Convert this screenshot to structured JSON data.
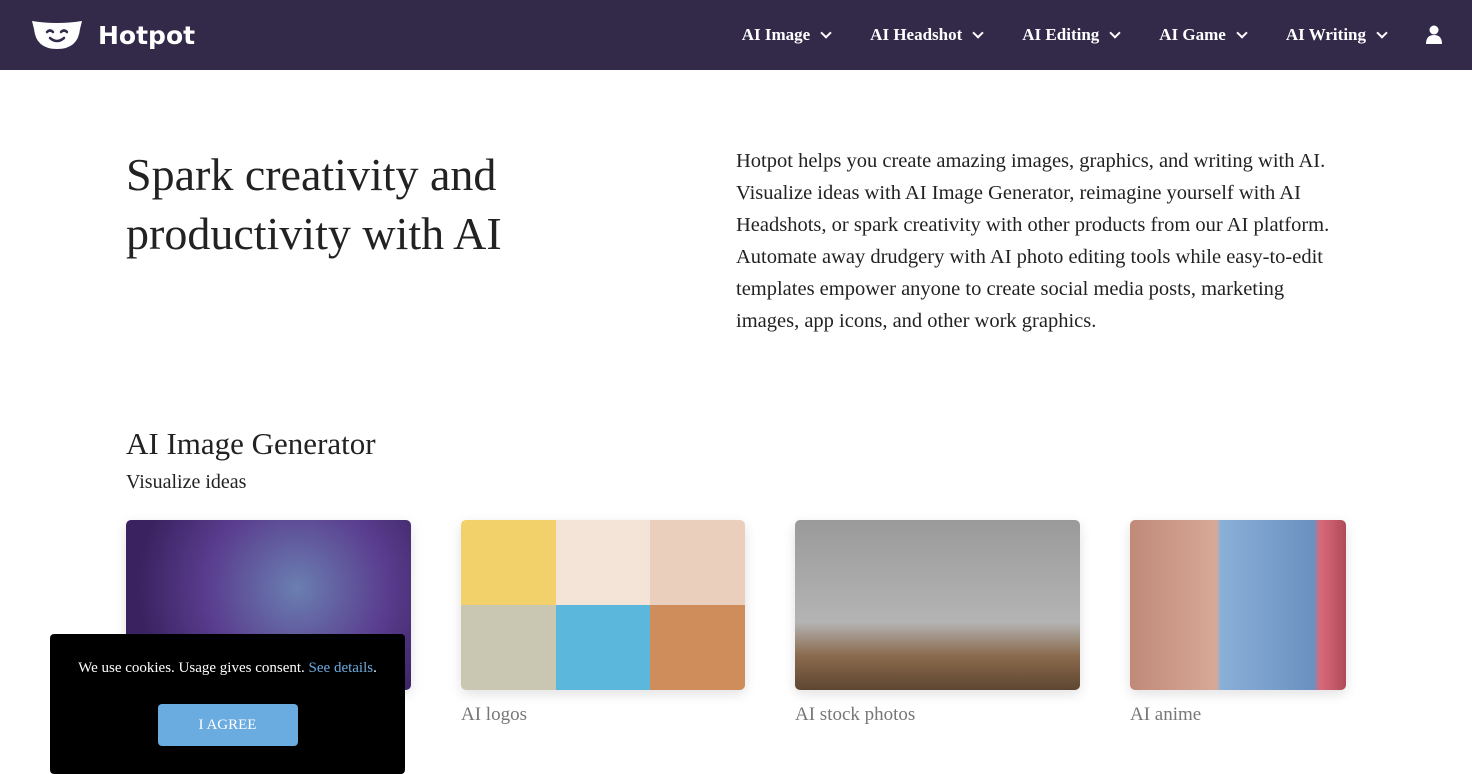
{
  "nav": {
    "brand": "Hotpot",
    "items": [
      {
        "label": "AI Image"
      },
      {
        "label": "AI Headshot"
      },
      {
        "label": "AI Editing"
      },
      {
        "label": "AI Game"
      },
      {
        "label": "AI Writing"
      }
    ],
    "bg": "#332a4a"
  },
  "hero": {
    "title": "Spark creativity and productivity with AI",
    "description": "Hotpot helps you create amazing images, graphics, and writing with AI. Visualize ideas with AI Image Generator, reimagine yourself with AI Headshots, or spark creativity with other products from our AI platform. Automate away drudgery with AI photo editing tools while easy-to-edit templates empower anyone to create social media posts, marketing images, app icons, and other work graphics."
  },
  "section": {
    "title": "AI Image Generator",
    "subtitle": "Visualize ideas",
    "cards": [
      {
        "label": ""
      },
      {
        "label": "AI logos"
      },
      {
        "label": "AI stock photos"
      },
      {
        "label": "AI anime"
      }
    ]
  },
  "cookie": {
    "text": "We use cookies. Usage gives consent. ",
    "link": "See details",
    "period": ".",
    "button": "I AGREE"
  }
}
